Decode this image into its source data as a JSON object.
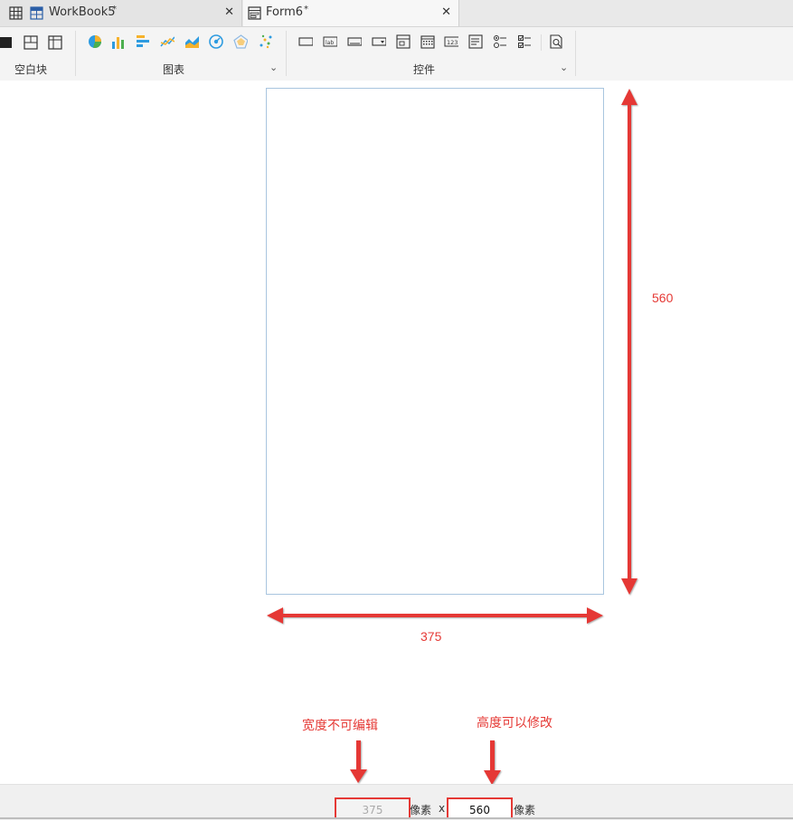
{
  "tabs": [
    {
      "label": "WorkBook5",
      "modified": "*"
    },
    {
      "label": "Form6",
      "modified": "*"
    }
  ],
  "toolbar": {
    "groups": [
      {
        "label": "空白块"
      },
      {
        "label": "图表"
      },
      {
        "label": "控件"
      }
    ]
  },
  "canvas": {
    "width_label": "375",
    "height_label": "560"
  },
  "annotations": {
    "width_note": "宽度不可编辑",
    "height_note": "高度可以修改"
  },
  "statusbar": {
    "width_value": "375",
    "unit1": "像素",
    "times": "x",
    "height_value": "560",
    "unit2": "像素"
  },
  "colors": {
    "accent_red": "#e53935",
    "canvas_border": "#a9c5df"
  }
}
